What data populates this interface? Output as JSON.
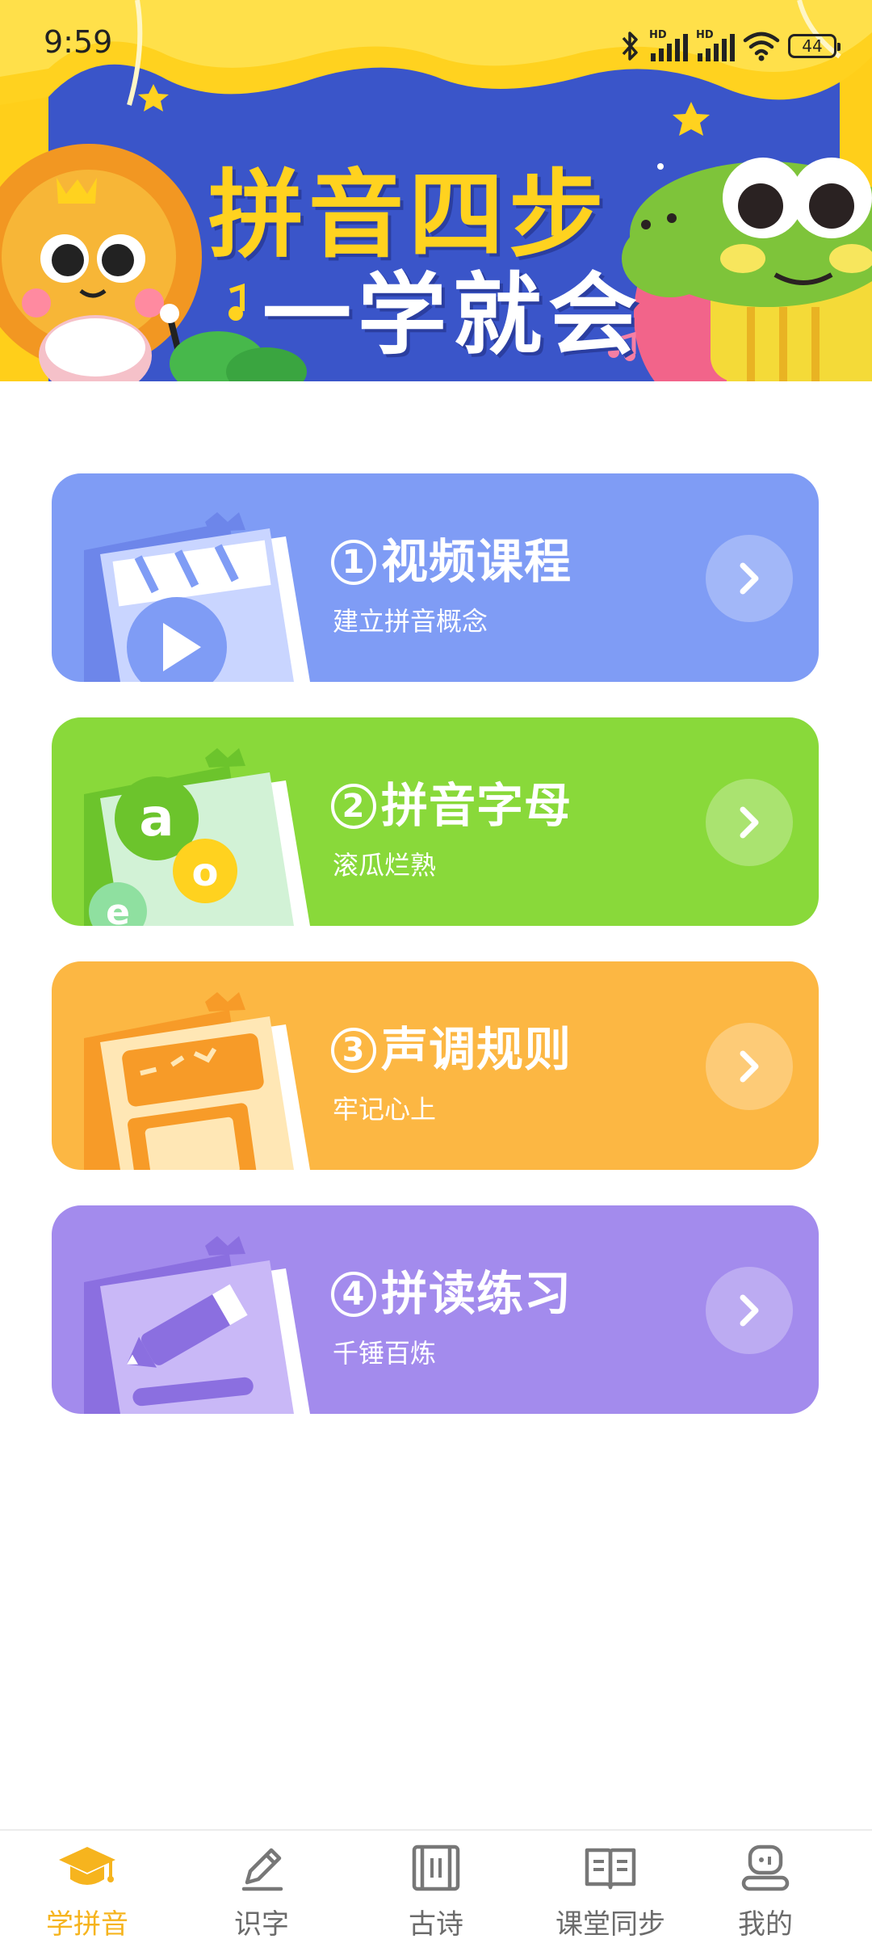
{
  "status_bar": {
    "time": "9:59",
    "battery": "44",
    "signal_label_1": "HD",
    "signal_label_2": "HD"
  },
  "banner": {
    "title_line1": "拼音四步",
    "title_line2": "一学就会"
  },
  "cards": [
    {
      "num": "1",
      "title": "视频课程",
      "subtitle": "建立拼音概念",
      "color": "#7f9cf5"
    },
    {
      "num": "2",
      "title": "拼音字母",
      "subtitle": "滚瓜烂熟",
      "color": "#89d93a"
    },
    {
      "num": "3",
      "title": "声调规则",
      "subtitle": "牢记心上",
      "color": "#fcb743"
    },
    {
      "num": "4",
      "title": "拼读练习",
      "subtitle": "千锤百炼",
      "color": "#a38bed"
    }
  ],
  "card_art_letters": [
    "a",
    "o",
    "e"
  ],
  "bottom_nav": [
    {
      "label": "学拼音",
      "icon": "graduation-cap-icon",
      "active": true
    },
    {
      "label": "识字",
      "icon": "pencil-icon",
      "active": false
    },
    {
      "label": "古诗",
      "icon": "scroll-icon",
      "active": false
    },
    {
      "label": "课堂同步",
      "icon": "open-book-icon",
      "active": false
    },
    {
      "label": "我的",
      "icon": "robot-profile-icon",
      "active": false
    }
  ],
  "colors": {
    "accent": "#f6b41e",
    "banner_blue": "#3a55c9",
    "curtain_yellow": "#ffd21f"
  }
}
